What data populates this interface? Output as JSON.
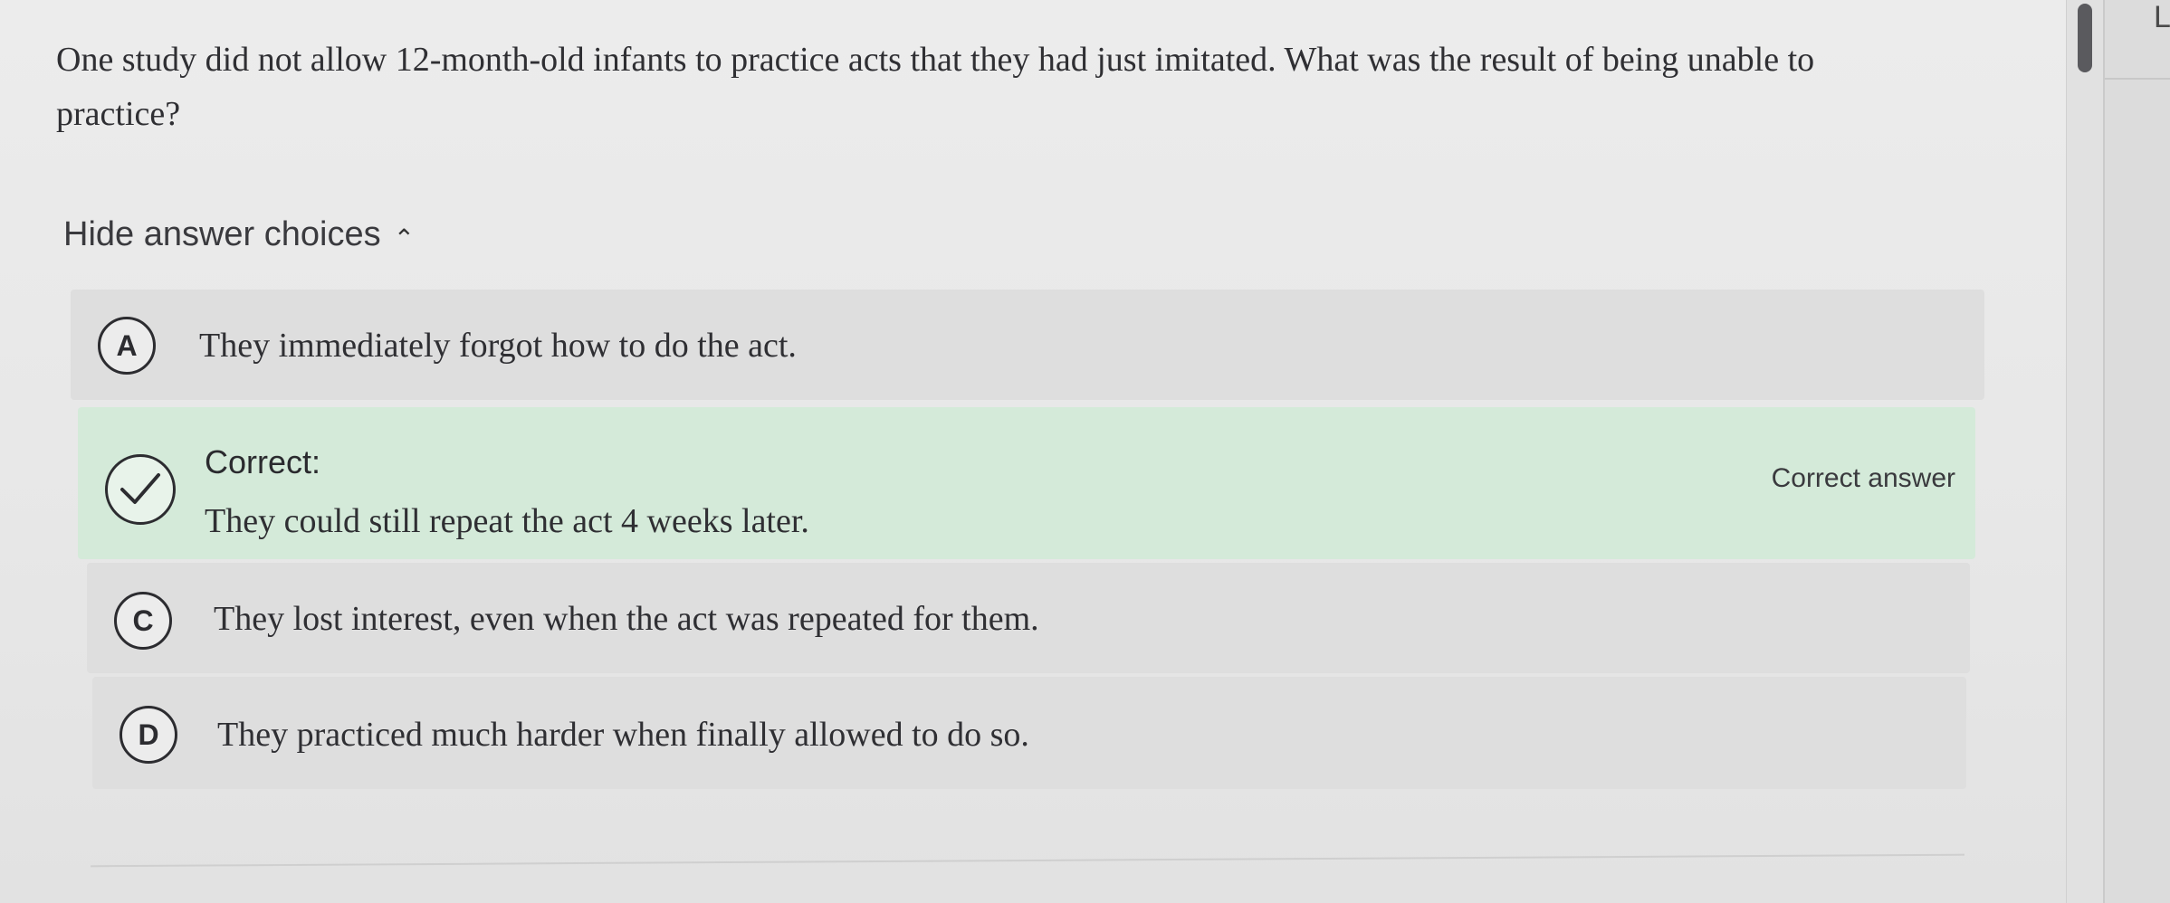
{
  "question": {
    "text": "One study did not allow 12-month-old infants to practice acts that they had just imitated. What was the result of being unable to practice?"
  },
  "toggle": {
    "label": "Hide answer choices",
    "icon": "chevron-up-icon"
  },
  "choices": [
    {
      "letter": "A",
      "text": "They immediately forgot how to do the act."
    },
    {
      "status_label": "Correct:",
      "text": "They could still repeat the act 4 weeks later.",
      "tag": "Correct answer",
      "icon": "check-circle-icon"
    },
    {
      "letter": "C",
      "text": "They lost interest, even when the act was repeated for them."
    },
    {
      "letter": "D",
      "text": "They practiced much harder when finally allowed to do so."
    }
  ],
  "right_panel": {
    "glyph": "L"
  },
  "colors": {
    "correct_background": "#d4ead9",
    "choice_background": "#dedede",
    "text": "#2f2f33"
  }
}
